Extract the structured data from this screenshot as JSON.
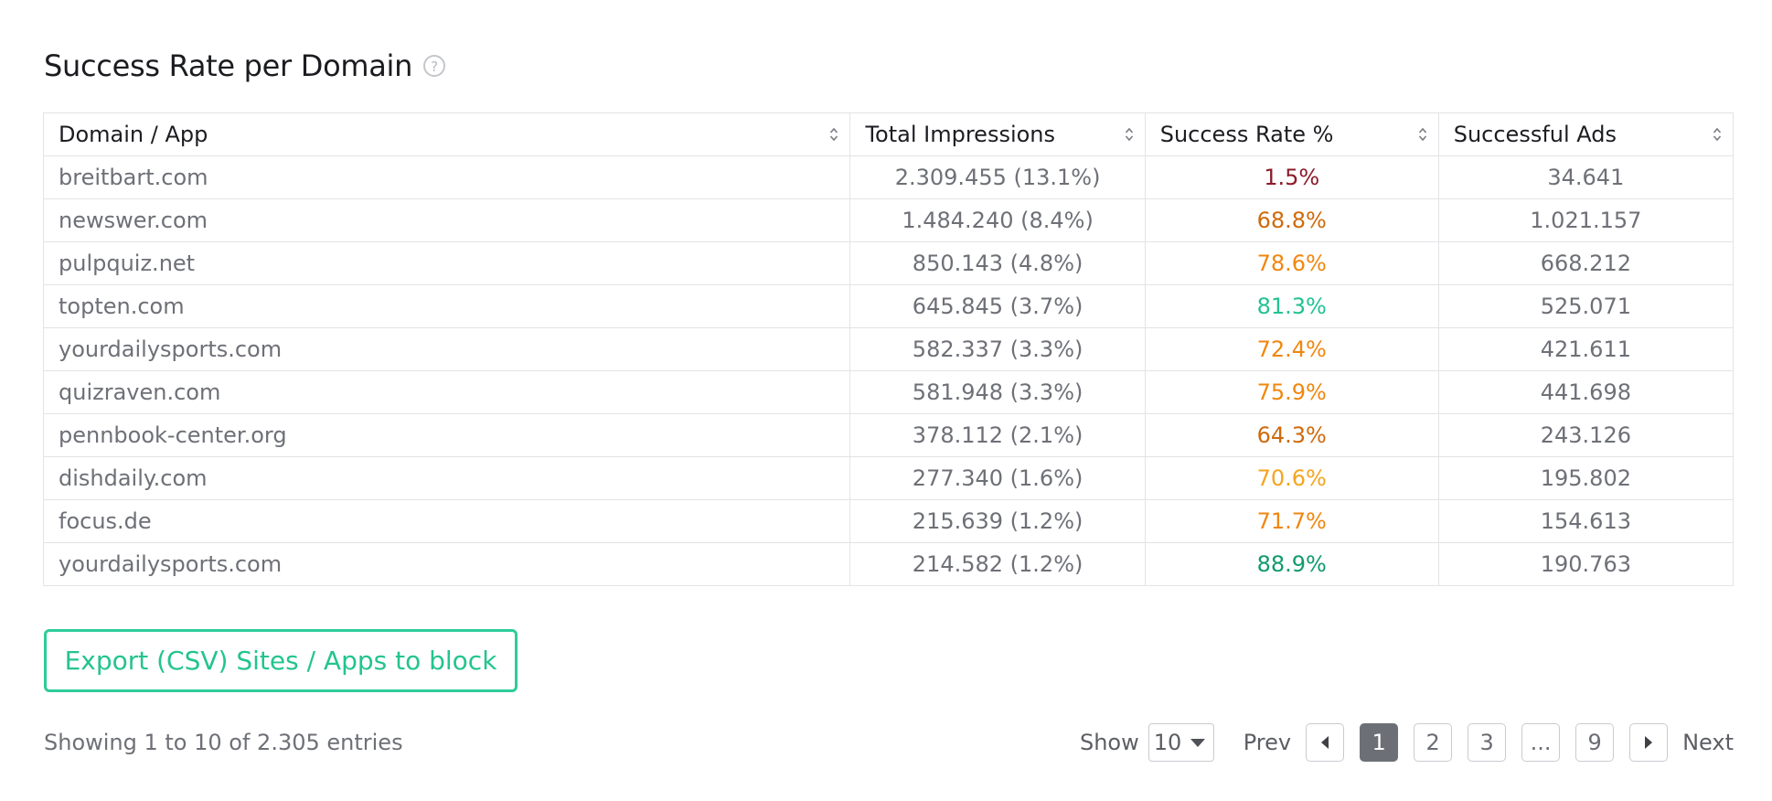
{
  "section": {
    "title": "Success Rate per Domain"
  },
  "table": {
    "columns": [
      "Domain / App",
      "Total Impressions",
      "Success Rate %",
      "Successful Ads"
    ],
    "rows": [
      {
        "domain": "breitbart.com",
        "impressions": "2.309.455 (13.1%)",
        "success_rate": "1.5%",
        "rate_color": "#8b1c2a",
        "successful_ads": "34.641"
      },
      {
        "domain": "newswer.com",
        "impressions": "1.484.240 (8.4%)",
        "success_rate": "68.8%",
        "rate_color": "#cf6a0c",
        "successful_ads": "1.021.157"
      },
      {
        "domain": "pulpquiz.net",
        "impressions": "850.143 (4.8%)",
        "success_rate": "78.6%",
        "rate_color": "#f0870f",
        "successful_ads": "668.212"
      },
      {
        "domain": "topten.com",
        "impressions": "645.845 (3.7%)",
        "success_rate": "81.3%",
        "rate_color": "#22c293",
        "successful_ads": "525.071"
      },
      {
        "domain": "yourdailysports.com",
        "impressions": "582.337 (3.3%)",
        "success_rate": "72.4%",
        "rate_color": "#f0870f",
        "successful_ads": "421.611"
      },
      {
        "domain": "quizraven.com",
        "impressions": "581.948 (3.3%)",
        "success_rate": "75.9%",
        "rate_color": "#f0870f",
        "successful_ads": "441.698"
      },
      {
        "domain": "pennbook-center.org",
        "impressions": "378.112 (2.1%)",
        "success_rate": "64.3%",
        "rate_color": "#cf6a0c",
        "successful_ads": "243.126"
      },
      {
        "domain": "dishdaily.com",
        "impressions": "277.340 (1.6%)",
        "success_rate": "70.6%",
        "rate_color": "#f3a51f",
        "successful_ads": "195.802"
      },
      {
        "domain": "focus.de",
        "impressions": "215.639 (1.2%)",
        "success_rate": "71.7%",
        "rate_color": "#f0870f",
        "successful_ads": "154.613"
      },
      {
        "domain": "yourdailysports.com",
        "impressions": "214.582 (1.2%)",
        "success_rate": "88.9%",
        "rate_color": "#119a6e",
        "successful_ads": "190.763"
      }
    ]
  },
  "export_button": {
    "label": "Export (CSV) Sites / Apps to block"
  },
  "footer": {
    "entries_text": "Showing 1 to 10 of 2.305 entries",
    "show_label": "Show",
    "page_size": "10",
    "prev_label": "Prev",
    "next_label": "Next",
    "pages": [
      "1",
      "2",
      "3",
      "...",
      "9"
    ],
    "active_page": "1"
  }
}
